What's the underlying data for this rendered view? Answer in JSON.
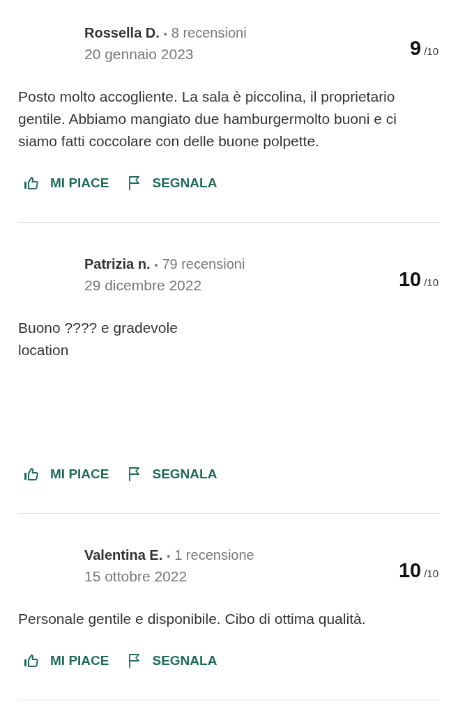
{
  "reviews": [
    {
      "author": "Rossella D.",
      "separator": "•",
      "review_count": "8 recensioni",
      "date": "20 gennaio 2023",
      "score": "9",
      "score_max": "/10",
      "text": "Posto molto accogliente. La sala è piccolina, il proprietario gentile. Abbiamo mangiato due hamburgermolto buoni e ci siamo fatti coccolare con delle buone polpette.",
      "actions": [
        {
          "kind": "like",
          "label": "MI PIACE"
        },
        {
          "kind": "report",
          "label": "SEGNALA"
        }
      ]
    },
    {
      "author": "Patrizia n.",
      "separator": "•",
      "review_count": "79 recensioni",
      "date": "29 dicembre 2022",
      "score": "10",
      "score_max": "/10",
      "text": "Buono ???? e gradevole\nlocation",
      "actions": [
        {
          "kind": "like",
          "label": "MI PIACE"
        },
        {
          "kind": "report",
          "label": "SEGNALA"
        }
      ]
    },
    {
      "author": "Valentina E.",
      "separator": "•",
      "review_count": "1 recensione",
      "date": "15 ottobre 2022",
      "score": "10",
      "score_max": "/10",
      "text": "Personale gentile e disponibile. Cibo di ottima qualità.",
      "actions": [
        {
          "kind": "like",
          "label": "MI PIACE"
        },
        {
          "kind": "report",
          "label": "SEGNALA"
        }
      ]
    }
  ]
}
